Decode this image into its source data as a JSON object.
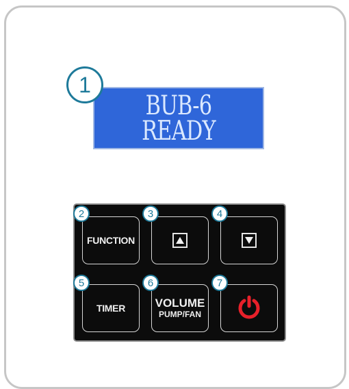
{
  "display": {
    "line1": "BUB-6",
    "line2": "READY",
    "callout": "1"
  },
  "keypad": {
    "keys": [
      {
        "callout": "2",
        "label": "FUNCTION"
      },
      {
        "callout": "3",
        "icon": "up-triangle-icon"
      },
      {
        "callout": "4",
        "icon": "down-triangle-icon"
      },
      {
        "callout": "5",
        "label": "TIMER"
      },
      {
        "callout": "6",
        "label": "VOLUME",
        "sublabel": "PUMP/FAN"
      },
      {
        "callout": "7",
        "icon": "power-icon"
      }
    ]
  },
  "colors": {
    "display_bg": "#2f66d9",
    "display_text": "#dbe9ff",
    "callout": "#1e7a9a",
    "power": "#e8202a",
    "keypad_bg": "#0c0c0c"
  }
}
